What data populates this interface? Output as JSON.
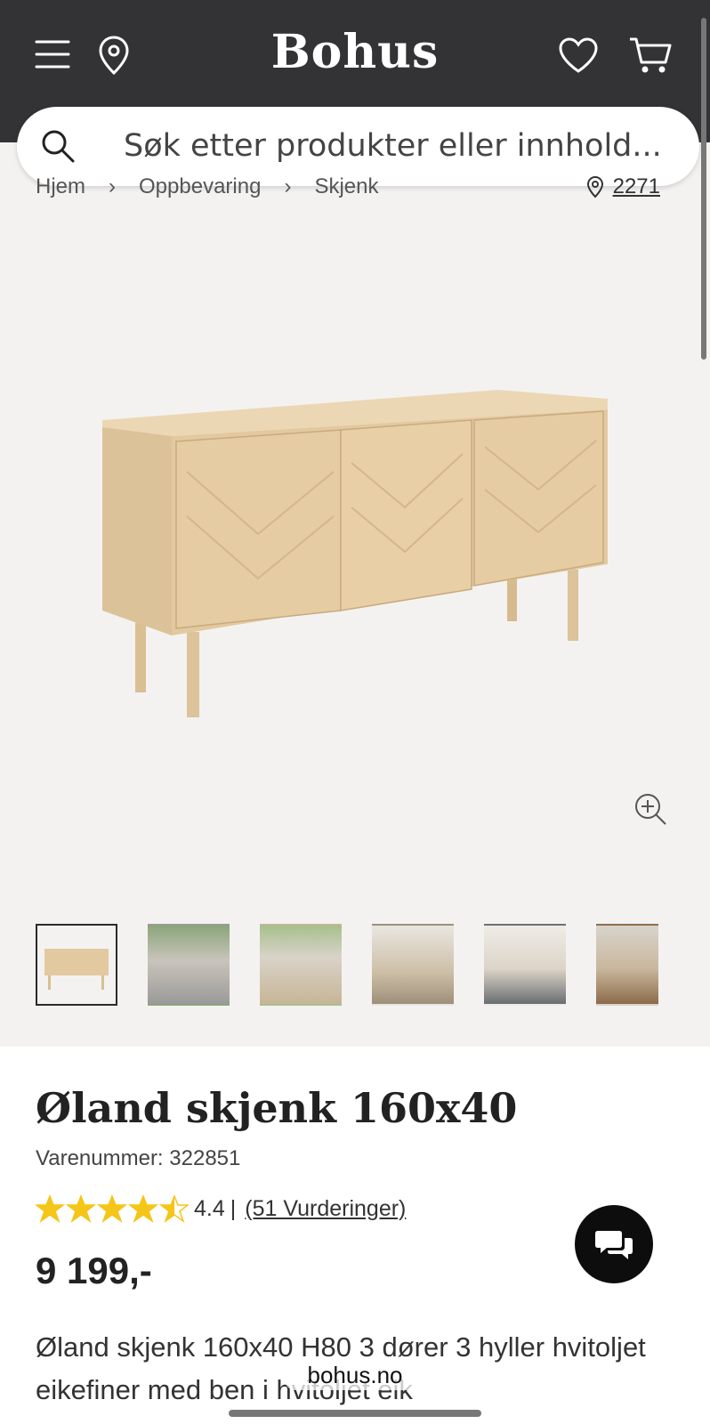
{
  "header": {
    "logo": "Bohus",
    "icons": [
      "menu-icon",
      "location-pin-icon",
      "heart-icon",
      "cart-icon"
    ]
  },
  "search": {
    "placeholder": "Søk etter produkter eller innhold..."
  },
  "breadcrumb": {
    "items": [
      "Hjem",
      "Oppbevaring",
      "Skjenk"
    ],
    "separator": "›"
  },
  "store": {
    "label": "2271"
  },
  "product": {
    "title": "Øland skjenk 160x40",
    "sku": "Varenummer: 322851",
    "rating_value": "4.4",
    "rating_stars": 4.4,
    "rating_separator": "|",
    "reviews": "(51 Vurderinger)",
    "price": "9 199,-",
    "description": "Øland skjenk 160x40 H80 3 dører 3 hyller hvitoljet eikefiner med ben i hvitoljet eik"
  },
  "gallery": {
    "thumb_count": 6,
    "selected_index": 0
  },
  "browser": {
    "domain": "bohus.no"
  },
  "colors": {
    "header_bg": "#333336",
    "star": "#f5c518",
    "page_bg": "#f4f2f1"
  }
}
